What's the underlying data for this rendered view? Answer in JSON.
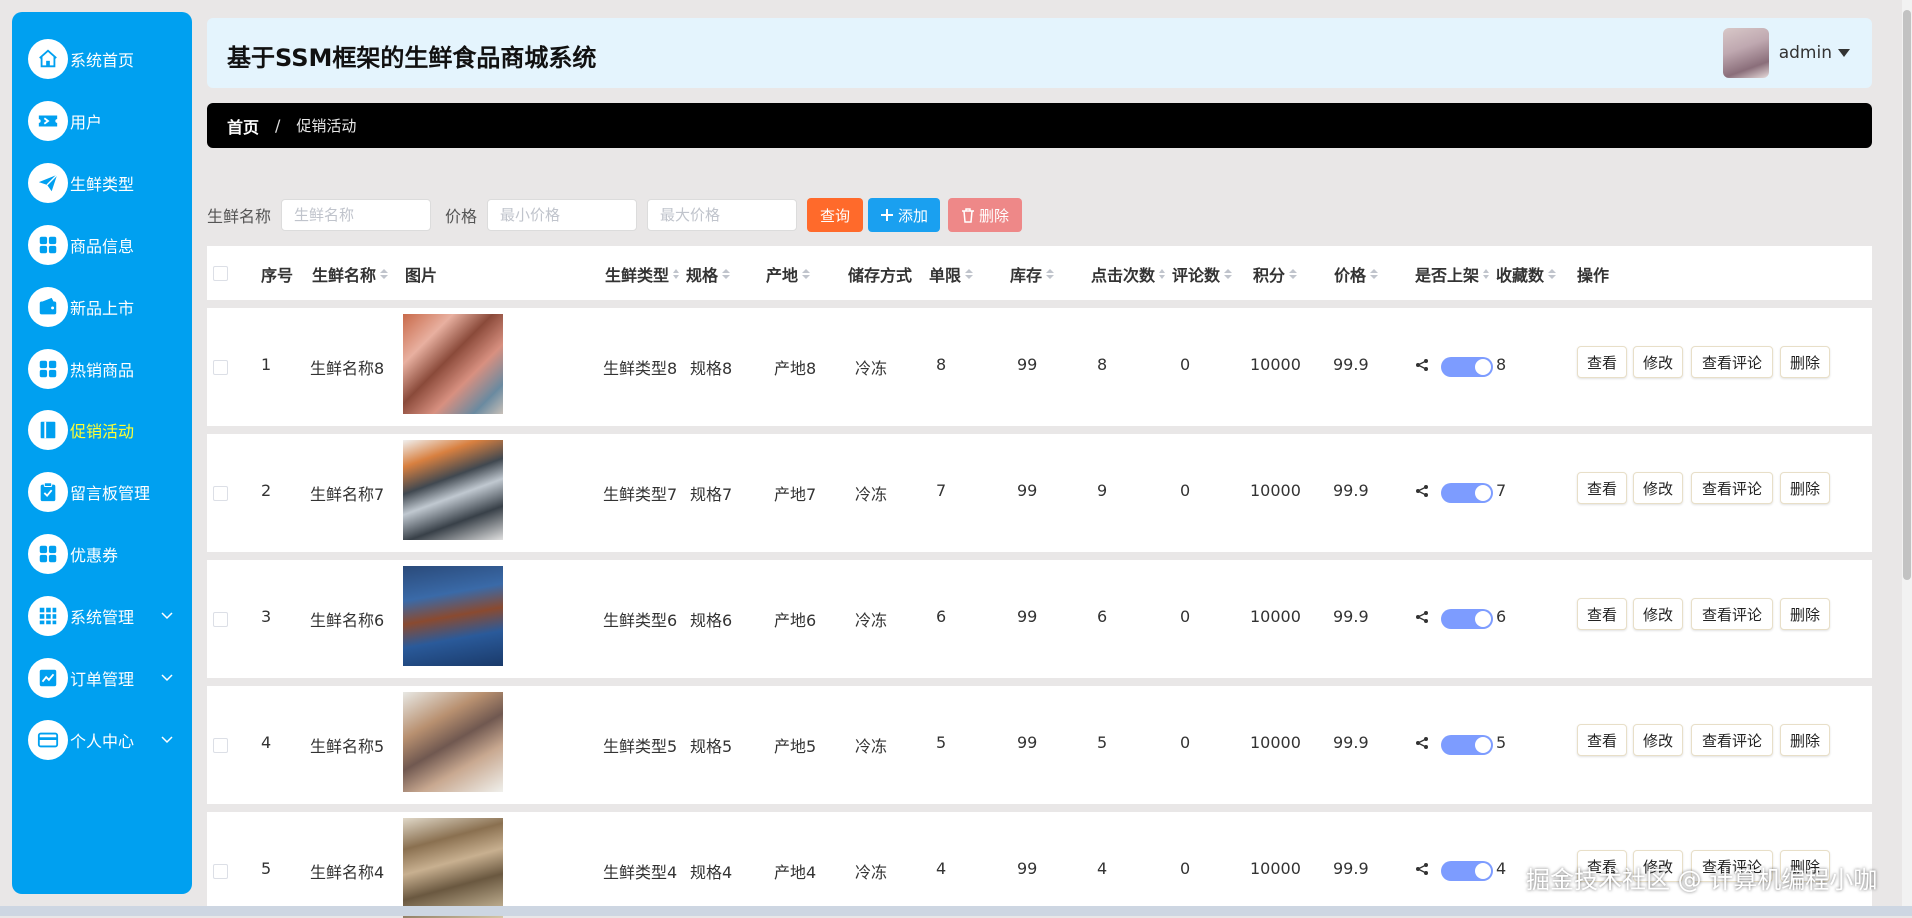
{
  "app": {
    "title": "基于SSM框架的生鲜食品商城系统"
  },
  "user": {
    "name": "admin"
  },
  "sidebar": {
    "items": [
      {
        "label": "系统首页",
        "icon": "home-icon"
      },
      {
        "label": "用户",
        "icon": "ticket-icon"
      },
      {
        "label": "生鲜类型",
        "icon": "paper-plane-icon"
      },
      {
        "label": "商品信息",
        "icon": "grid-icon"
      },
      {
        "label": "新品上市",
        "icon": "wallet-icon"
      },
      {
        "label": "热销商品",
        "icon": "grid-icon"
      },
      {
        "label": "促销活动",
        "icon": "book-icon",
        "active": true
      },
      {
        "label": "留言板管理",
        "icon": "clipboard-icon"
      },
      {
        "label": "优惠券",
        "icon": "grid-icon"
      },
      {
        "label": "系统管理",
        "icon": "apps-icon",
        "expandable": true
      },
      {
        "label": "订单管理",
        "icon": "chart-icon",
        "expandable": true
      },
      {
        "label": "个人中心",
        "icon": "card-icon",
        "expandable": true
      }
    ]
  },
  "breadcrumb": {
    "home": "首页",
    "separator": "/",
    "current": "促销活动"
  },
  "search": {
    "name_label": "生鲜名称",
    "name_placeholder": "生鲜名称",
    "price_label": "价格",
    "min_placeholder": "最小价格",
    "max_placeholder": "最大价格",
    "query_label": "查询",
    "add_label": "添加",
    "delete_label": "删除"
  },
  "table": {
    "headers": [
      "序号",
      "生鲜名称",
      "图片",
      "生鲜类型",
      "规格",
      "产地",
      "储存方式",
      "单限",
      "库存",
      "点击次数",
      "评论数",
      "积分",
      "价格",
      "是否上架",
      "收藏数",
      "操作"
    ],
    "rows": [
      {
        "index": "1",
        "name": "生鲜名称8",
        "type": "生鲜类型8",
        "spec": "规格8",
        "origin": "产地8",
        "storage": "冷冻",
        "limit": "8",
        "stock": "99",
        "clicks": "8",
        "comments": "0",
        "points": "10000",
        "price": "99.9",
        "favorites": "8",
        "on_shelf": true
      },
      {
        "index": "2",
        "name": "生鲜名称7",
        "type": "生鲜类型7",
        "spec": "规格7",
        "origin": "产地7",
        "storage": "冷冻",
        "limit": "7",
        "stock": "99",
        "clicks": "9",
        "comments": "0",
        "points": "10000",
        "price": "99.9",
        "favorites": "7",
        "on_shelf": true
      },
      {
        "index": "3",
        "name": "生鲜名称6",
        "type": "生鲜类型6",
        "spec": "规格6",
        "origin": "产地6",
        "storage": "冷冻",
        "limit": "6",
        "stock": "99",
        "clicks": "6",
        "comments": "0",
        "points": "10000",
        "price": "99.9",
        "favorites": "6",
        "on_shelf": true
      },
      {
        "index": "4",
        "name": "生鲜名称5",
        "type": "生鲜类型5",
        "spec": "规格5",
        "origin": "产地5",
        "storage": "冷冻",
        "limit": "5",
        "stock": "99",
        "clicks": "5",
        "comments": "0",
        "points": "10000",
        "price": "99.9",
        "favorites": "5",
        "on_shelf": true
      },
      {
        "index": "5",
        "name": "生鲜名称4",
        "type": "生鲜类型4",
        "spec": "规格4",
        "origin": "产地4",
        "storage": "冷冻",
        "limit": "4",
        "stock": "99",
        "clicks": "4",
        "comments": "0",
        "points": "10000",
        "price": "99.9",
        "favorites": "4",
        "on_shelf": true
      }
    ],
    "actions": {
      "view": "查看",
      "edit": "修改",
      "view_comments": "查看评论",
      "delete": "删除"
    }
  },
  "watermark": "掘金技术社区 @ 计算机编程小咖",
  "colors": {
    "sidebar": "#00a0f0",
    "active_nav": "#ffff33",
    "query": "#ff6a2b",
    "add": "#1aa0f0",
    "delete": "#ee8888",
    "toggle_on": "#7d9cff"
  }
}
